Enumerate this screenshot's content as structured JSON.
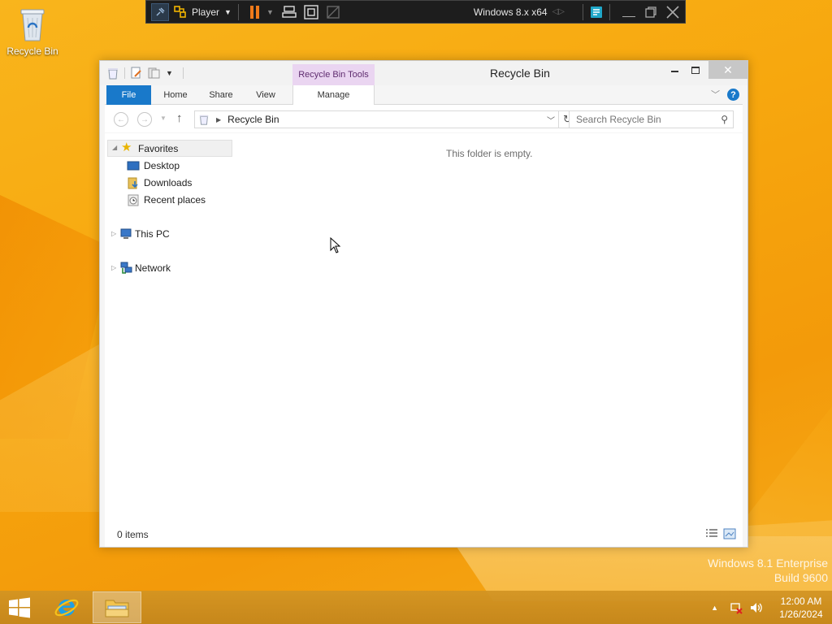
{
  "desktop": {
    "recycle_bin_label": "Recycle Bin",
    "watermark_line1": "Windows 8.1 Enterprise",
    "watermark_line2": "Build 9600"
  },
  "vm_player": {
    "player_label": "Player",
    "vm_title": "Windows 8.x x64"
  },
  "window": {
    "title": "Recycle Bin",
    "contextual_tab_group": "Recycle Bin Tools",
    "tabs": {
      "file": "File",
      "home": "Home",
      "share": "Share",
      "view": "View",
      "manage": "Manage"
    },
    "address": {
      "crumb": "Recycle Bin"
    },
    "search": {
      "placeholder": "Search Recycle Bin"
    },
    "nav_pane": {
      "favorites": "Favorites",
      "desktop": "Desktop",
      "downloads": "Downloads",
      "recent_places": "Recent places",
      "this_pc": "This PC",
      "network": "Network"
    },
    "empty_message": "This folder is empty.",
    "status": {
      "item_count": "0 items"
    }
  },
  "taskbar": {
    "time": "12:00 AM",
    "date": "1/26/2024"
  },
  "colors": {
    "accent": "#1979ca",
    "contextual_tab_bg": "#ead5f1",
    "desktop_bg": "#f7a70e"
  }
}
